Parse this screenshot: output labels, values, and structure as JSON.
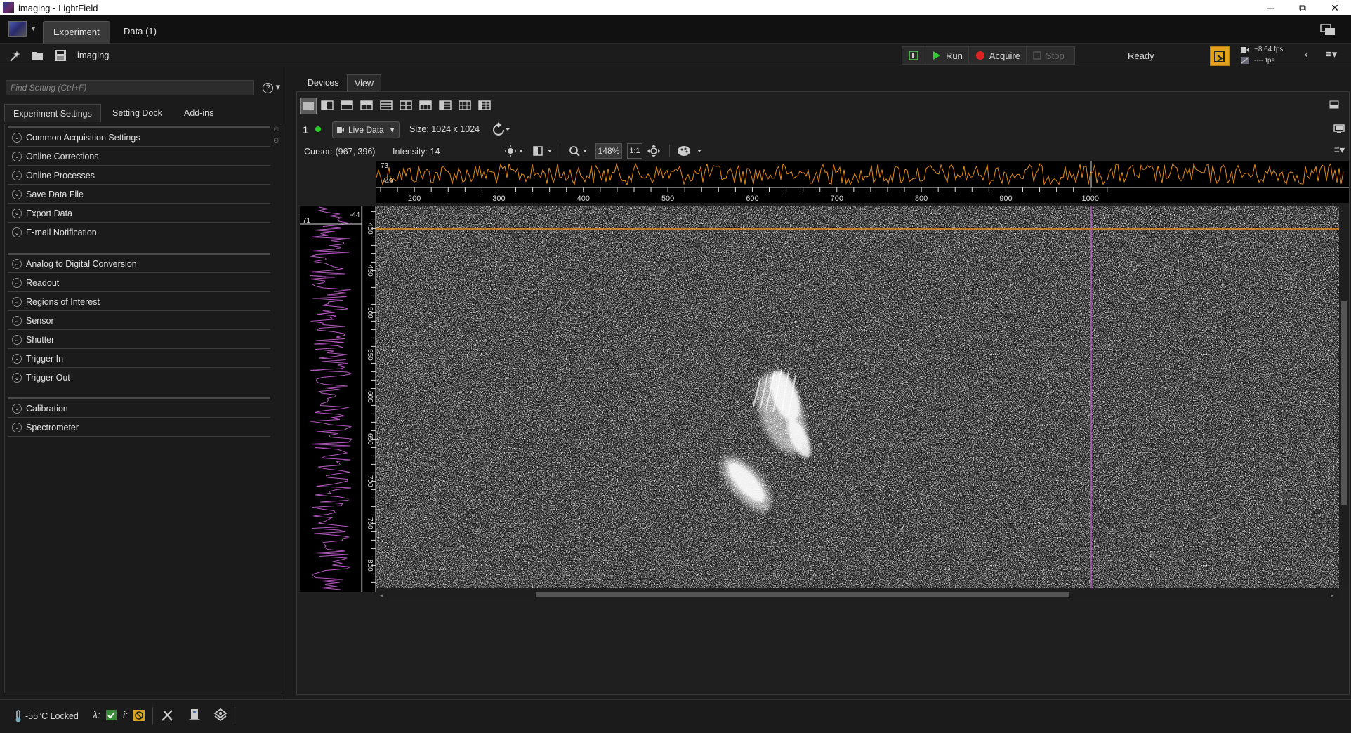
{
  "window": {
    "title": "imaging - LightField",
    "minimize": "─",
    "maximize": "⧉",
    "close": "✕"
  },
  "main_tabs": [
    {
      "label": "Experiment"
    },
    {
      "label": "Data (1)"
    }
  ],
  "toolbar": {
    "experiment_name": "imaging",
    "run_label": "Run",
    "acquire_label": "Acquire",
    "stop_label": "Stop",
    "status": "Ready",
    "fps_top": "~8.64 fps",
    "fps_bottom": "---- fps"
  },
  "left_panel": {
    "search_placeholder": "Find Setting (Ctrl+F)",
    "help": "?",
    "tabs": [
      {
        "label": "Experiment Settings"
      },
      {
        "label": "Setting Dock"
      },
      {
        "label": "Add-ins"
      }
    ],
    "groups": [
      {
        "items": [
          "Common Acquisition Settings",
          "Online Corrections",
          "Online Processes",
          "Save Data File",
          "Export Data",
          "E-mail Notification"
        ]
      },
      {
        "items": [
          "Analog to Digital Conversion",
          "Readout",
          "Regions of Interest",
          "Sensor",
          "Shutter",
          "Trigger In",
          "Trigger Out"
        ]
      },
      {
        "items": [
          "Calibration",
          "Spectrometer"
        ]
      }
    ]
  },
  "status_bar": {
    "temperature": "-55°C Locked",
    "lambda": "λ:",
    "intensity_i": "i:"
  },
  "view_panel": {
    "tabs": [
      {
        "label": "Devices"
      },
      {
        "label": "View"
      }
    ],
    "channel": "1",
    "source": "Live Data",
    "size": "Size: 1024 x 1024",
    "cursor": "Cursor: (967, 396)",
    "intensity": "Intensity: 14",
    "zoom": "148%",
    "zoom_one": "1:1",
    "top_profile": {
      "max_label": "73",
      "min_label": "-49",
      "x_ticks": [
        "200",
        "300",
        "400",
        "500",
        "600",
        "700",
        "800",
        "900",
        "1000"
      ]
    },
    "side_profile": {
      "max_label": "71",
      "min_label": "-44",
      "y_ticks": [
        "400",
        "450",
        "500",
        "550",
        "600",
        "650",
        "700",
        "750",
        "800"
      ]
    },
    "colors": {
      "row_profile": "#e48a1a",
      "col_profile": "#b45ac0",
      "cursor_row": "#e48a1a",
      "cursor_col": "#b45ac0"
    }
  }
}
